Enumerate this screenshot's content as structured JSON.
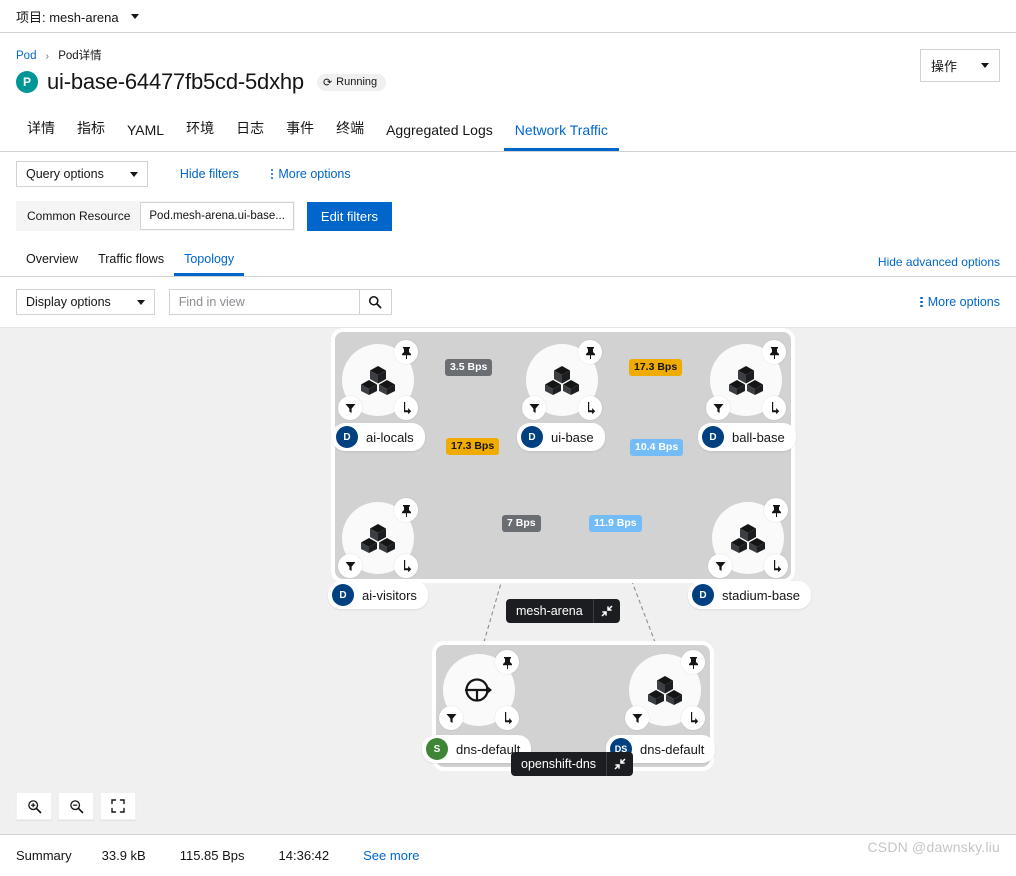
{
  "project_bar": {
    "label": "项目: mesh-arena"
  },
  "header": {
    "breadcrumb_root": "Pod",
    "breadcrumb_current": "Pod详情",
    "kind_badge": "P",
    "title": "ui-base-64477fb5cd-5dxhp",
    "status": "Running",
    "actions_label": "操作"
  },
  "main_tabs": [
    {
      "label": "详情",
      "active": false
    },
    {
      "label": "指标",
      "active": false
    },
    {
      "label": "YAML",
      "active": false
    },
    {
      "label": "环境",
      "active": false
    },
    {
      "label": "日志",
      "active": false
    },
    {
      "label": "事件",
      "active": false
    },
    {
      "label": "终端",
      "active": false
    },
    {
      "label": "Aggregated Logs",
      "active": false
    },
    {
      "label": "Network Traffic",
      "active": true
    }
  ],
  "query_bar": {
    "query_options": "Query options",
    "hide_filters": "Hide filters",
    "more_options": "More options"
  },
  "filters": {
    "chip_label": "Common Resource",
    "chip_value": "Pod.mesh-arena.ui-base...",
    "edit_filters": "Edit filters"
  },
  "sub_tabs": [
    {
      "label": "Overview",
      "active": false
    },
    {
      "label": "Traffic flows",
      "active": false
    },
    {
      "label": "Topology",
      "active": true
    }
  ],
  "advanced_link": "Hide advanced options",
  "display_bar": {
    "display_options": "Display options",
    "find_placeholder": "Find in view",
    "find_value": "",
    "more_options": "More options"
  },
  "topology": {
    "groups": [
      {
        "name": "mesh-arena",
        "pill_label": "mesh-arena",
        "collapse_icon": "collapse-icon"
      },
      {
        "name": "openshift-dns",
        "pill_label": "openshift-dns",
        "collapse_icon": "collapse-icon"
      }
    ],
    "nodes": [
      {
        "id": "ai-locals",
        "label": "ai-locals",
        "kind": "D",
        "icon": "deployment-icon"
      },
      {
        "id": "ui-base",
        "label": "ui-base",
        "kind": "D",
        "icon": "deployment-icon"
      },
      {
        "id": "ball-base",
        "label": "ball-base",
        "kind": "D",
        "icon": "deployment-icon"
      },
      {
        "id": "ai-visitors",
        "label": "ai-visitors",
        "kind": "D",
        "icon": "deployment-icon"
      },
      {
        "id": "stadium-base",
        "label": "stadium-base",
        "kind": "D",
        "icon": "deployment-icon"
      },
      {
        "id": "dns-service",
        "label": "dns-default",
        "kind": "S",
        "icon": "service-icon"
      },
      {
        "id": "dns-daemonset",
        "label": "dns-default",
        "kind": "DS",
        "icon": "deployment-icon"
      }
    ],
    "edges": [
      {
        "from": "ui-base",
        "to": "ai-locals",
        "rate": "3.5 Bps",
        "color": "gray"
      },
      {
        "from": "ui-base",
        "to": "ball-base",
        "rate": "17.3 Bps",
        "color": "orange"
      },
      {
        "from": "ai-visitors",
        "to": "ui-base",
        "rate": "17.3 Bps",
        "color": "orange"
      },
      {
        "from": "ui-base",
        "to": "stadium-base",
        "rate": "10.4 Bps",
        "color": "blue"
      },
      {
        "from": "dns-service",
        "to": "ui-base",
        "rate": "7 Bps",
        "color": "gray"
      },
      {
        "from": "dns-daemonset",
        "to": "ui-base",
        "rate": "11.9 Bps",
        "color": "blue"
      }
    ],
    "zoom_controls": [
      {
        "name": "zoom-in-icon"
      },
      {
        "name": "zoom-out-icon"
      },
      {
        "name": "fit-to-screen-icon"
      }
    ]
  },
  "summary": {
    "label": "Summary",
    "bytes": "33.9 kB",
    "rate": "115.85 Bps",
    "time": "14:36:42",
    "see_more": "See more"
  },
  "watermark": "CSDN @dawnsky.liu"
}
